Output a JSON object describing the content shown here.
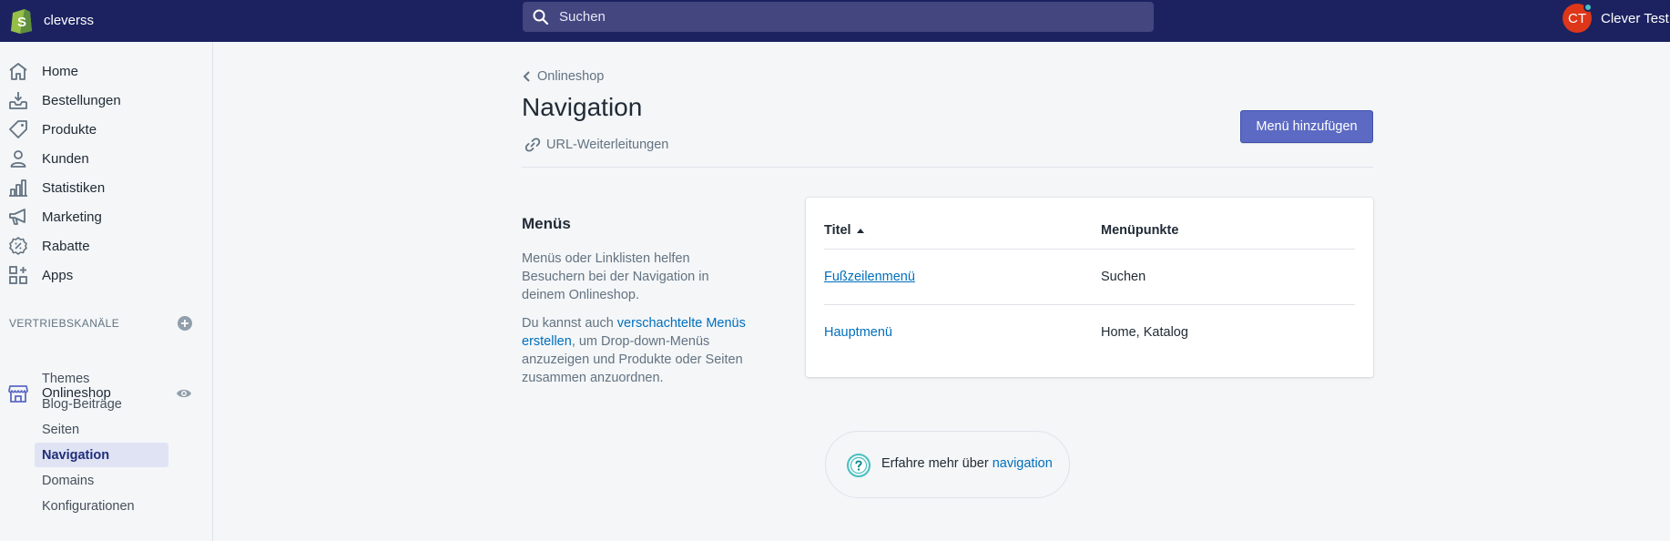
{
  "topbar": {
    "store_name": "cleverss",
    "search_placeholder": "Suchen",
    "user_initials": "CT",
    "user_name": "Clever Test"
  },
  "sidebar": {
    "items": [
      {
        "label": "Home",
        "icon": "home-icon"
      },
      {
        "label": "Bestellungen",
        "icon": "orders-icon"
      },
      {
        "label": "Produkte",
        "icon": "tag-icon"
      },
      {
        "label": "Kunden",
        "icon": "customer-icon"
      },
      {
        "label": "Statistiken",
        "icon": "analytics-icon"
      },
      {
        "label": "Marketing",
        "icon": "megaphone-icon"
      },
      {
        "label": "Rabatte",
        "icon": "discount-icon"
      },
      {
        "label": "Apps",
        "icon": "apps-icon"
      }
    ],
    "sales_channels_label": "VERTRIEBSKANÄLE",
    "channel_label": "Onlineshop",
    "sub_items": [
      {
        "label": "Themes"
      },
      {
        "label": "Blog-Beiträge"
      },
      {
        "label": "Seiten"
      },
      {
        "label": "Navigation",
        "active": true
      },
      {
        "label": "Domains"
      },
      {
        "label": "Konfigurationen"
      }
    ]
  },
  "header": {
    "breadcrumb": "Onlineshop",
    "title": "Navigation",
    "redirect_link": "URL-Weiterleitungen",
    "add_menu_button": "Menü hinzufügen"
  },
  "menus_section": {
    "heading": "Menüs",
    "description1": "Menüs oder Linklisten helfen Besuchern bei der Navigation in deinem Onlineshop.",
    "description2_prefix": "Du kannst auch ",
    "description2_link": "verschachtelte Menüs erstellen",
    "description2_suffix": ", um Drop-down-Menüs anzuzeigen und Produkte oder Seiten zusammen anzuordnen."
  },
  "table": {
    "col_title": "Titel",
    "col_items": "Menüpunkte",
    "rows": [
      {
        "title": "Fußzeilenmenü",
        "items": "Suchen"
      },
      {
        "title": "Hauptmenü",
        "items": "Home, Katalog"
      }
    ]
  },
  "help": {
    "prefix": "Erfahre mehr über ",
    "link": "navigation"
  },
  "colors": {
    "topbar": "#1c2260",
    "primary": "#5c6ac4",
    "link": "#006fbb",
    "avatar": "#de3618"
  }
}
